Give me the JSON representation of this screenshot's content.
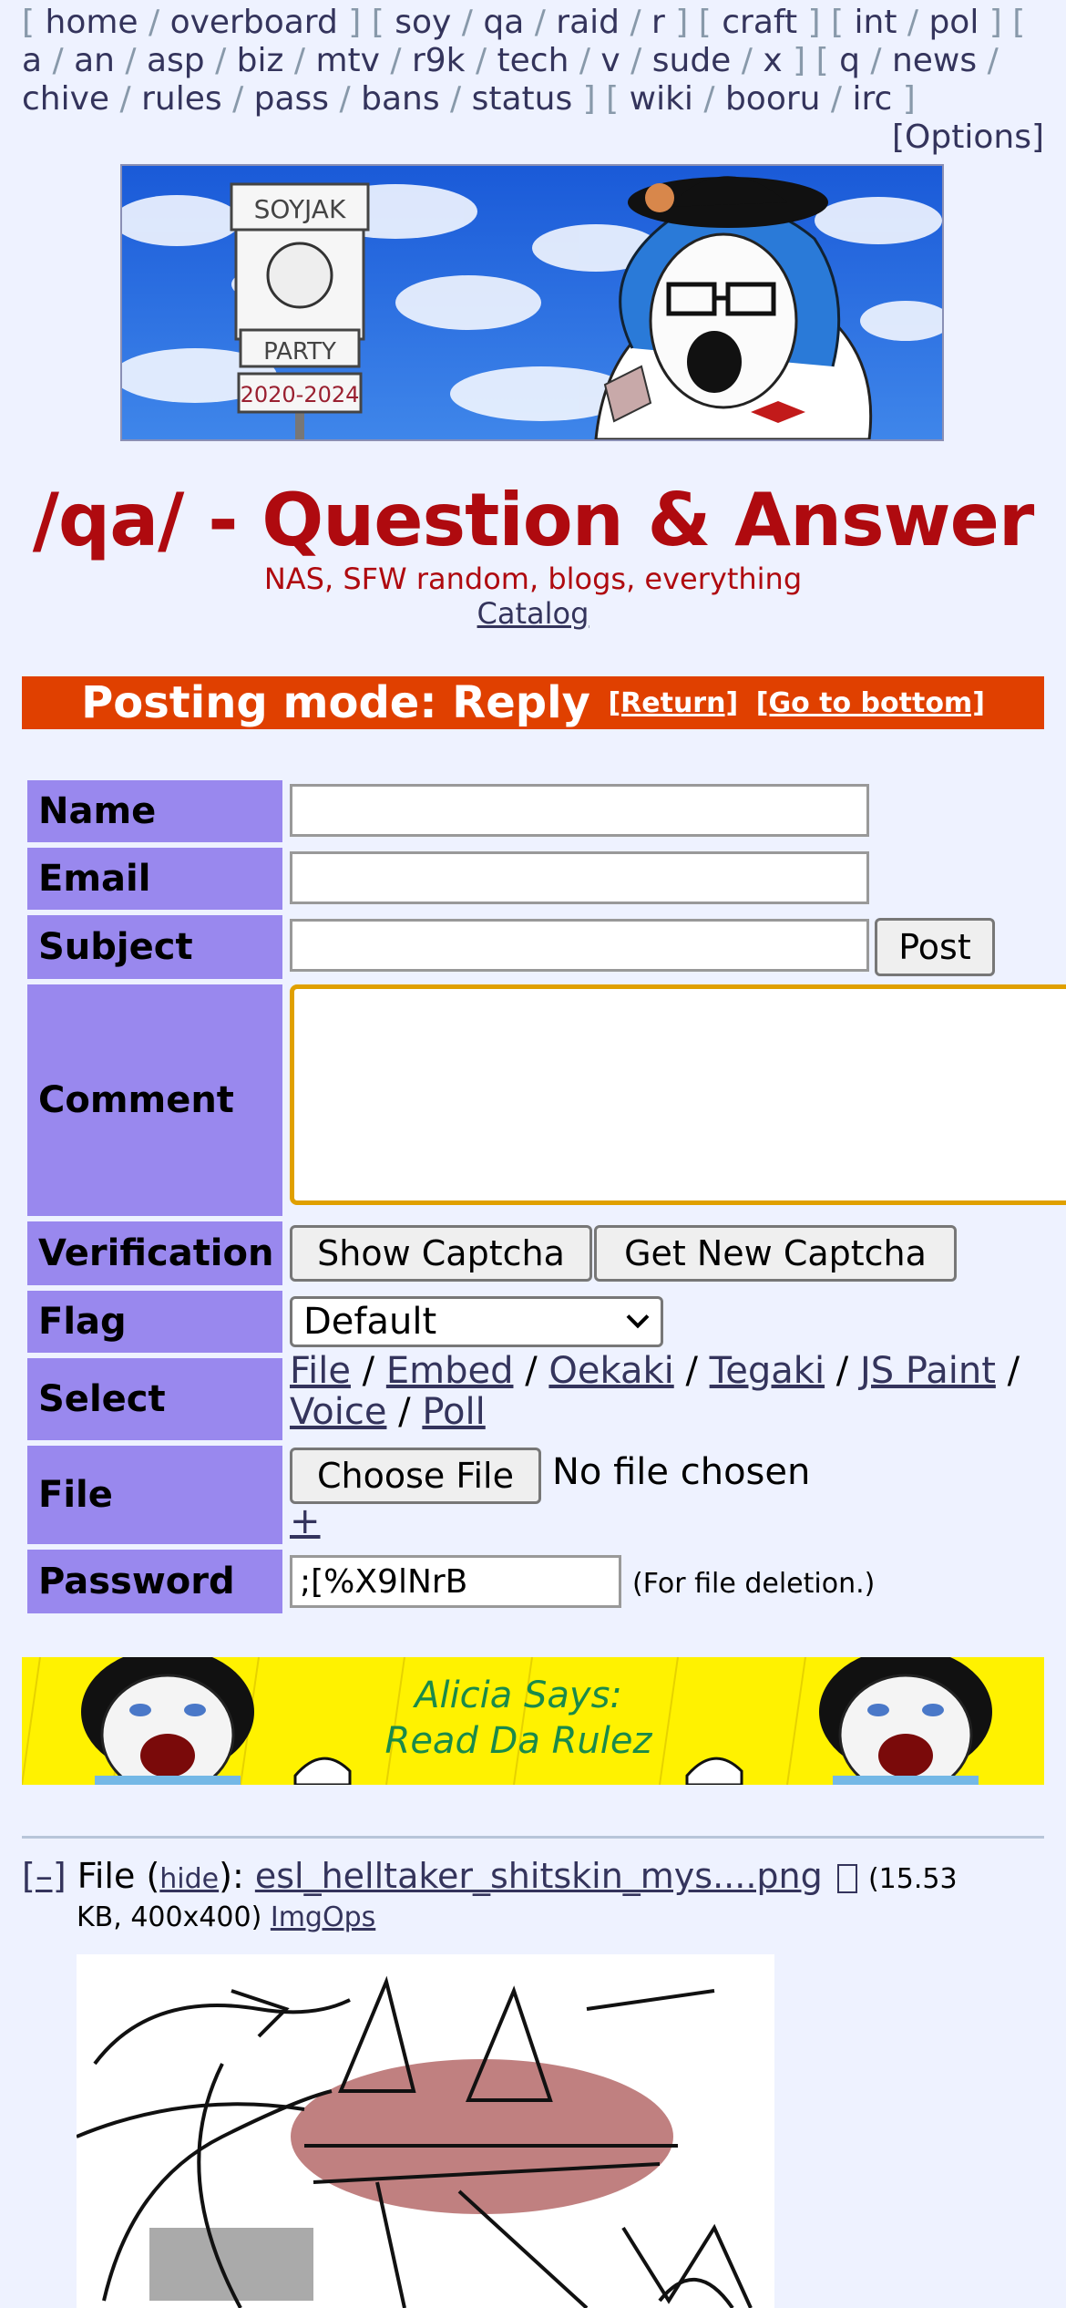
{
  "boardlist": {
    "groups": [
      [
        "home",
        "overboard"
      ],
      [
        "soy",
        "qa",
        "raid",
        "r"
      ],
      [
        "craft"
      ],
      [
        "int",
        "pol"
      ],
      [
        "a",
        "an",
        "asp",
        "biz",
        "mtv",
        "r9k",
        "tech",
        "v",
        "sude",
        "x"
      ],
      [
        "q",
        "news",
        "chive",
        "rules",
        "pass",
        "bans",
        "status"
      ],
      [
        "wiki",
        "booru",
        "irc"
      ]
    ],
    "options_label": "[Options]"
  },
  "banner": {
    "sign_top": "SOYJAK",
    "sign_bottom": "PARTY",
    "sign_years": "2020-2024"
  },
  "board": {
    "title": "/qa/ - Question & Answer",
    "subtitle": "NAS, SFW random, blogs, everything",
    "catalog_link": "Catalog"
  },
  "mode_bar": {
    "text": "Posting mode: Reply",
    "return_link": "[Return]",
    "bottom_link": "[Go to bottom]"
  },
  "form": {
    "name_label": "Name",
    "email_label": "Email",
    "subject_label": "Subject",
    "post_button": "Post",
    "comment_label": "Comment",
    "verification_label": "Verification",
    "show_captcha_button": "Show Captcha",
    "new_captcha_button": "Get New Captcha",
    "flag_label": "Flag",
    "flag_value": "Default",
    "select_label": "Select",
    "select_links": [
      "File",
      "Embed",
      "Oekaki",
      "Tegaki",
      "JS Paint",
      "Voice",
      "Poll"
    ],
    "file_label": "File",
    "choose_file_button": "Choose File",
    "file_status": "No file chosen",
    "add_file_link": "+",
    "password_label": "Password",
    "password_value": ";[%X9lNrB",
    "password_note": "(For file deletion.)"
  },
  "ad_banner": {
    "line1": "Alicia Says:",
    "line2": "Read Da Rulez"
  },
  "post": {
    "collapse": "[–]",
    "file_prefix": "File",
    "hide_link": "hide",
    "filename": "esl_helltaker_shitskin_mys....png",
    "size_start": "(15.53",
    "size_rest": "KB, 400x400)",
    "imgops": "ImgOps"
  },
  "colors": {
    "background": "#eef2ff",
    "title_red": "#af0a0f",
    "mode_bar": "#e04000",
    "label_bg": "#9988ee",
    "link": "#34345c",
    "comment_focus": "#e0a000",
    "ad_yellow": "#fff200"
  }
}
